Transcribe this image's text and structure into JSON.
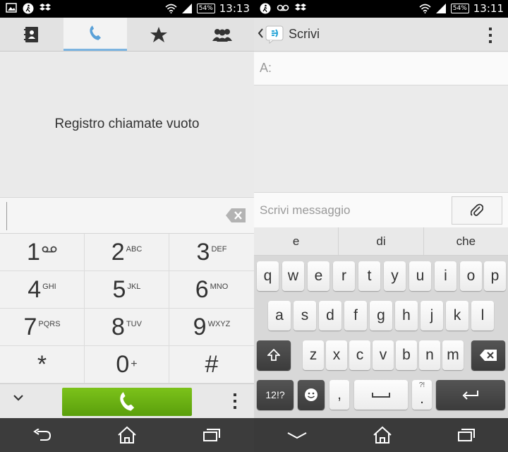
{
  "left": {
    "status": {
      "battery": "54%",
      "time": "13:13"
    },
    "call_log_empty_text": "Registro chiamate vuoto",
    "keypad": [
      {
        "digit": "1",
        "sub": "",
        "voicemail": true
      },
      {
        "digit": "2",
        "sub": "ABC"
      },
      {
        "digit": "3",
        "sub": "DEF"
      },
      {
        "digit": "4",
        "sub": "GHI"
      },
      {
        "digit": "5",
        "sub": "JKL"
      },
      {
        "digit": "6",
        "sub": "MNO"
      },
      {
        "digit": "7",
        "sub": "PQRS"
      },
      {
        "digit": "8",
        "sub": "TUV"
      },
      {
        "digit": "9",
        "sub": "WXYZ"
      },
      {
        "digit": "*",
        "sub": ""
      },
      {
        "digit": "0",
        "sub": "+"
      },
      {
        "digit": "#",
        "sub": ""
      }
    ],
    "colors": {
      "call_button": "#6cb416",
      "active_tab": "#7cb4e0"
    }
  },
  "right": {
    "status": {
      "battery": "54%",
      "time": "13:11"
    },
    "title": "Scrivi",
    "to_label": "A:",
    "compose_placeholder": "Scrivi messaggio",
    "suggestions": [
      "e",
      "di",
      "che"
    ],
    "keyboard": {
      "row1": [
        "q",
        "w",
        "e",
        "r",
        "t",
        "y",
        "u",
        "i",
        "o",
        "p"
      ],
      "row2": [
        "a",
        "s",
        "d",
        "f",
        "g",
        "h",
        "j",
        "k",
        "l"
      ],
      "row3": [
        "z",
        "x",
        "c",
        "v",
        "b",
        "n",
        "m"
      ],
      "symbols_key": "12!?",
      "comma_key": ",",
      "period_key": ".",
      "period_hint": "?!"
    }
  }
}
